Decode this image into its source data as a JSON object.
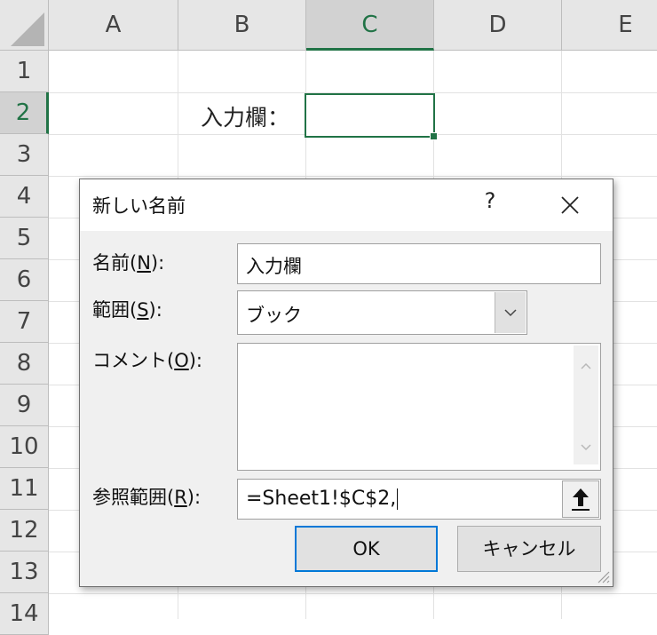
{
  "sheet": {
    "columns": [
      "A",
      "B",
      "C",
      "D",
      "E"
    ],
    "selected_column": "C",
    "rows": [
      "1",
      "2",
      "3",
      "4",
      "5",
      "6",
      "7",
      "8",
      "9",
      "10",
      "11",
      "12",
      "13",
      "14"
    ],
    "selected_row": "2",
    "cell_b2": "入力欄：",
    "active_cell": "C2",
    "accent_color": "#217346"
  },
  "dialog": {
    "title": "新しい名前",
    "help_label": "?",
    "close_icon": "close-icon",
    "name_label_pre": "名前(",
    "name_label_key": "N",
    "name_label_post": "):",
    "name_value": "入力欄",
    "scope_label_pre": "範囲(",
    "scope_label_key": "S",
    "scope_label_post": "):",
    "scope_value": "ブック",
    "comment_label_pre": "コメント(",
    "comment_label_key": "O",
    "comment_label_post": "):",
    "comment_value": "",
    "ref_label_pre": "参照範囲(",
    "ref_label_key": "R",
    "ref_label_post": "):",
    "ref_value": "=Sheet1!$C$2,",
    "ok_label": "OK",
    "cancel_label": "キャンセル"
  }
}
